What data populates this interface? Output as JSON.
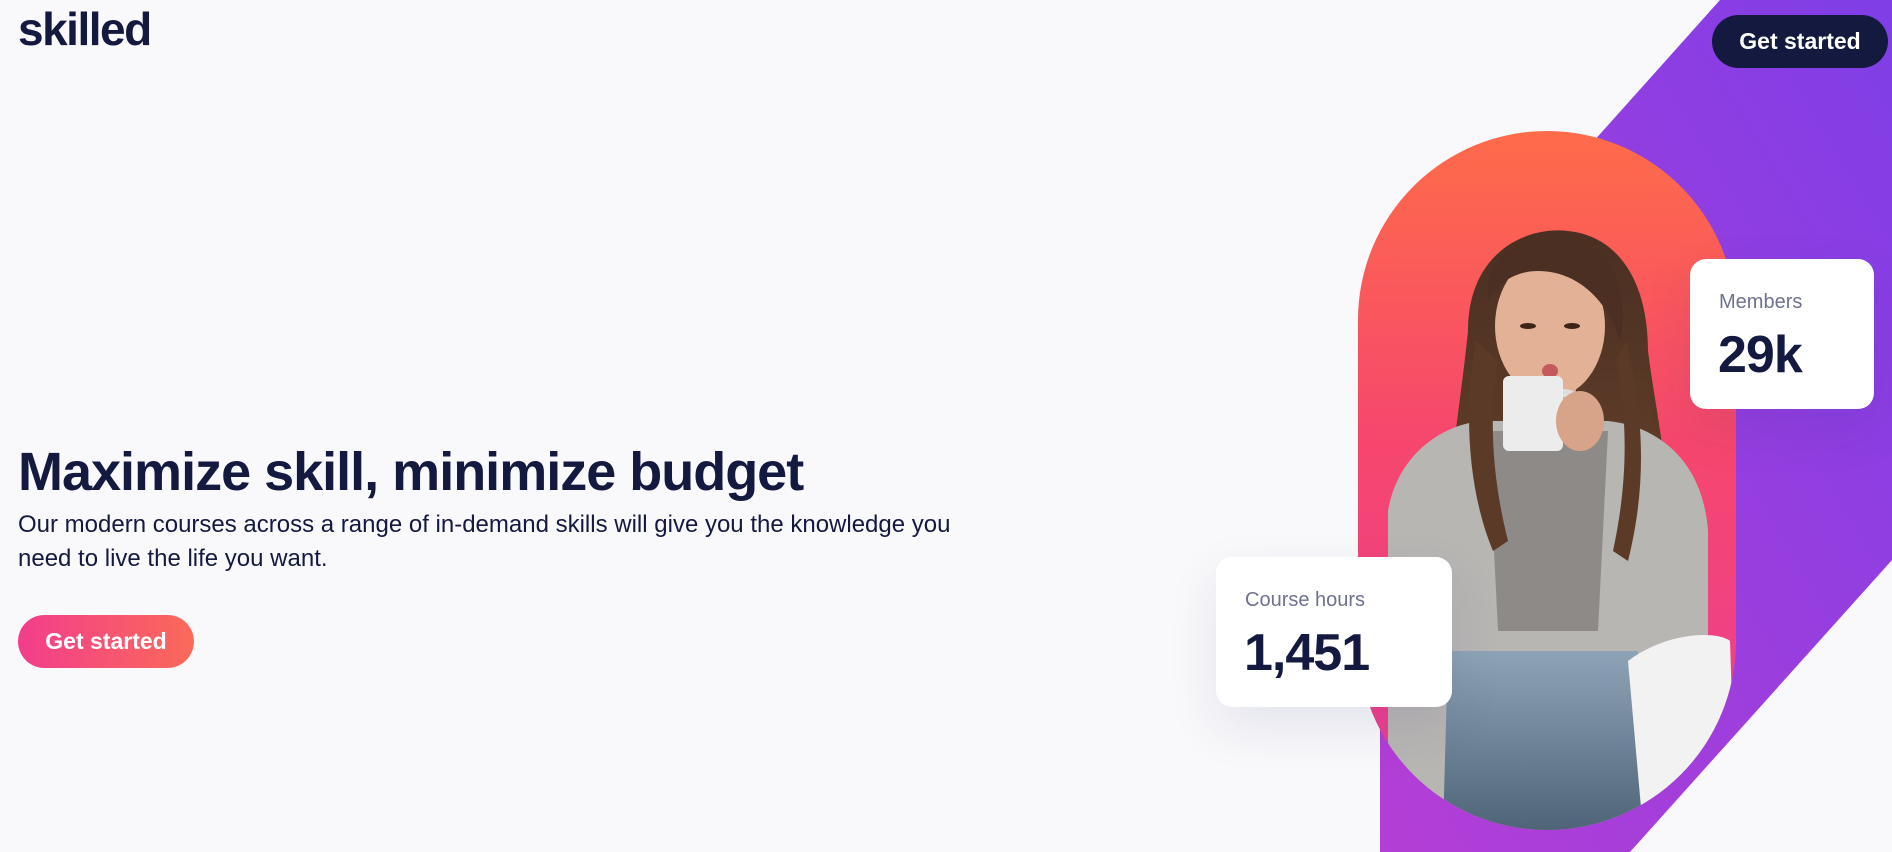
{
  "header": {
    "logo": "skilled",
    "cta_label": "Get started"
  },
  "hero": {
    "title": "Maximize skill, minimize budget",
    "description": "Our modern courses across a range of in-demand skills will give you the knowledge you need to live the life you want.",
    "cta_label": "Get started"
  },
  "stats": {
    "members": {
      "label": "Members",
      "value": "29k"
    },
    "course_hours": {
      "label": "Course hours",
      "value": "1,451"
    }
  },
  "colors": {
    "navy": "#14193f",
    "cta_gradient_start": "#f23d8c",
    "cta_gradient_end": "#fb6a59",
    "purple": "#7f3ee6",
    "orange": "#fe6c49",
    "pink": "#e93e99"
  },
  "icons": {
    "hero_image": "woman-with-mug-photo"
  }
}
